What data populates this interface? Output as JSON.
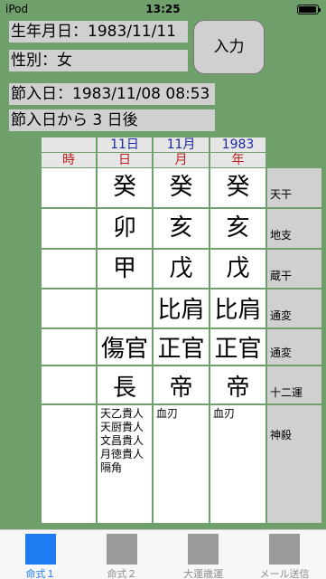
{
  "status": {
    "carrier": "iPod",
    "time": "13:25"
  },
  "info": {
    "birth": "生年月日：1983/11/11",
    "gender": "性別：女",
    "setsuiri": "節入日：1983/11/08 08:53",
    "after": "節入日から 3 日後"
  },
  "input_button": "入力",
  "header": {
    "day_value": "11日",
    "month_value": "11月",
    "year_value": "1983",
    "labels": [
      "時",
      "日",
      "月",
      "年"
    ]
  },
  "rows": [
    {
      "label": "天干",
      "cells": [
        "",
        "癸",
        "癸",
        "癸"
      ]
    },
    {
      "label": "地支",
      "cells": [
        "",
        "卯",
        "亥",
        "亥"
      ]
    },
    {
      "label": "蔵干",
      "cells": [
        "",
        "甲",
        "戊",
        "戊"
      ]
    },
    {
      "label": "通変",
      "cells": [
        "",
        "",
        "比肩",
        "比肩"
      ]
    },
    {
      "label": "通変",
      "cells": [
        "",
        "傷官",
        "正官",
        "正官"
      ]
    },
    {
      "label": "十二運",
      "cells": [
        "",
        "長",
        "帝",
        "帝"
      ]
    }
  ],
  "shinsatsu": {
    "label": "神殺",
    "day": [
      "天乙貴人",
      "天厨貴人",
      "文昌貴人",
      "月徳貴人",
      "隔角"
    ],
    "month": [
      "血刃"
    ],
    "year": [
      "血刃"
    ]
  },
  "tabs": [
    {
      "label": "命式１",
      "icon": "tab-meishiki1-icon",
      "active": true
    },
    {
      "label": "命式２",
      "icon": "tab-meishiki2-icon",
      "active": false
    },
    {
      "label": "大運歳運",
      "icon": "tab-taiun-icon",
      "active": false
    },
    {
      "label": "メール送信",
      "icon": "tab-mail-icon",
      "active": false
    }
  ],
  "colors": {
    "background": "#6f9f6a",
    "accent": "#1e7cf0",
    "header_blue": "#1a2aa0",
    "header_red": "#c02020"
  }
}
